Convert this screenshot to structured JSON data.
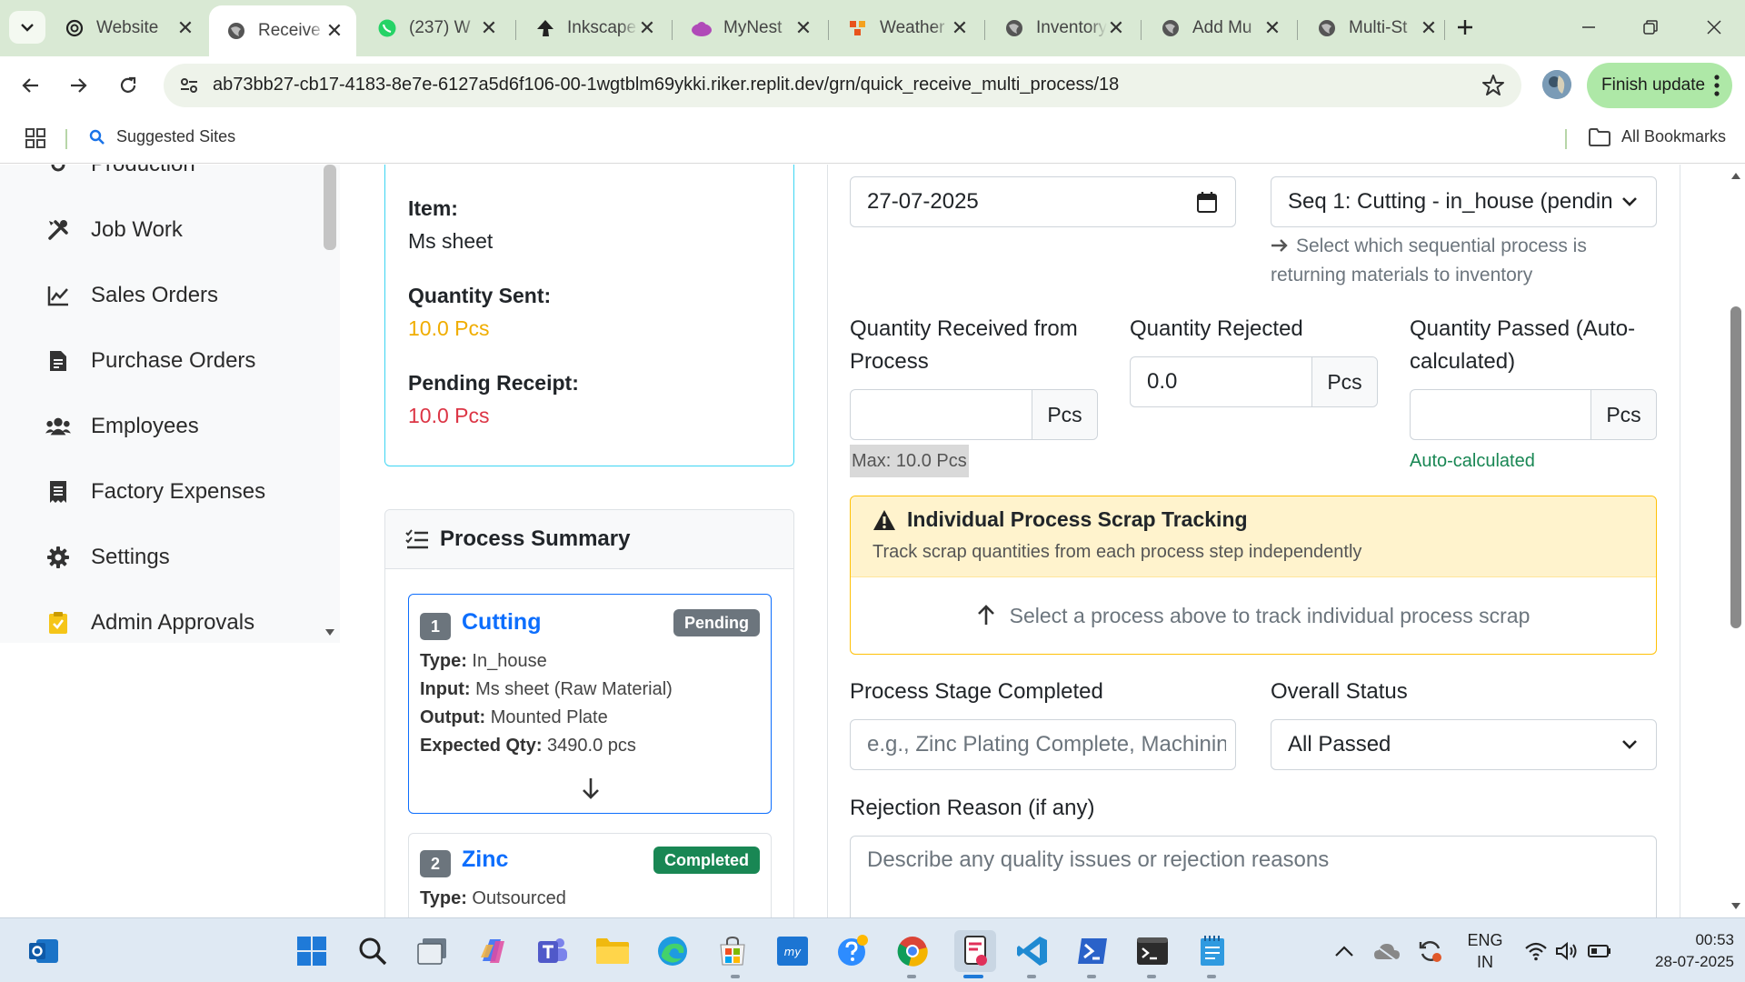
{
  "browser": {
    "tabs": [
      {
        "title": "Website",
        "icon": "openai-icon",
        "active": false
      },
      {
        "title": "Receive",
        "icon": "globe-icon",
        "active": true
      },
      {
        "title": "(237) W",
        "icon": "whatsapp-icon",
        "active": false
      },
      {
        "title": "Inkscape",
        "icon": "inkscape-icon",
        "active": false
      },
      {
        "title": "MyNest",
        "icon": "cloud-icon",
        "active": false
      },
      {
        "title": "Weather",
        "icon": "weather-icon",
        "active": false
      },
      {
        "title": "Inventory",
        "icon": "globe-icon",
        "active": false
      },
      {
        "title": "Add Mu",
        "icon": "globe-icon",
        "active": false
      },
      {
        "title": "Multi-St",
        "icon": "globe-icon",
        "active": false
      }
    ],
    "url": "ab73bb27-cb17-4183-8e7e-6127a5d6f106-00-1wgtblm69ykki.riker.replit.dev/grn/quick_receive_multi_process/18",
    "finish_update": "Finish update",
    "bookmarks": {
      "suggested": "Suggested Sites",
      "all": "All Bookmarks"
    }
  },
  "sidebar": {
    "items": [
      {
        "label": "Production",
        "icon": "production-icon"
      },
      {
        "label": "Job Work",
        "icon": "tools-icon"
      },
      {
        "label": "Sales Orders",
        "icon": "chart-line-icon"
      },
      {
        "label": "Purchase Orders",
        "icon": "document-icon"
      },
      {
        "label": "Employees",
        "icon": "users-icon"
      },
      {
        "label": "Factory Expenses",
        "icon": "receipt-icon"
      },
      {
        "label": "Settings",
        "icon": "gear-icon"
      },
      {
        "label": "Admin Approvals",
        "icon": "clipboard-check-icon"
      }
    ]
  },
  "info_card": {
    "item_label": "Item:",
    "item_value": "Ms sheet",
    "qty_sent_label": "Quantity Sent:",
    "qty_sent_value": "10.0 Pcs",
    "pending_label": "Pending Receipt:",
    "pending_value": "10.0 Pcs"
  },
  "process_summary": {
    "title": "Process Summary",
    "processes": [
      {
        "seq": "1",
        "name": "Cutting",
        "status": "Pending",
        "type_label": "Type:",
        "type": "In_house",
        "input_label": "Input:",
        "input": "Ms sheet (Raw Material)",
        "output_label": "Output:",
        "output": "Mounted Plate",
        "expected_label": "Expected Qty:",
        "expected": "3490.0 pcs"
      },
      {
        "seq": "2",
        "name": "Zinc",
        "status": "Completed",
        "type_label": "Type:",
        "type": "Outsourced"
      }
    ]
  },
  "form": {
    "date_value": "27-07-2025",
    "process_select": "Seq 1: Cutting - in_house (pendin",
    "process_hint": "Select which sequential process is returning materials to inventory",
    "qty_received_label": "Quantity Received from Process",
    "qty_received_value": "",
    "qty_received_unit": "Pcs",
    "qty_received_max": "Max: 10.0 Pcs",
    "qty_rejected_label": "Quantity Rejected",
    "qty_rejected_value": "0.0",
    "qty_rejected_unit": "Pcs",
    "qty_passed_label": "Quantity Passed (Auto-calculated)",
    "qty_passed_value": "",
    "qty_passed_unit": "Pcs",
    "qty_passed_note": "Auto-calculated",
    "scrap": {
      "title": "Individual Process Scrap Tracking",
      "subtitle": "Track scrap quantities from each process step independently",
      "body": "Select a process above to track individual process scrap"
    },
    "stage_label": "Process Stage Completed",
    "stage_placeholder": "e.g., Zinc Plating Complete, Machining Done",
    "status_label": "Overall Status",
    "status_value": "All Passed",
    "rejection_label": "Rejection Reason (if any)",
    "rejection_placeholder": "Describe any quality issues or rejection reasons"
  },
  "taskbar": {
    "lang_top": "ENG",
    "lang_bottom": "IN",
    "time": "00:53",
    "date": "28-07-2025"
  },
  "colors": {
    "tabstrip": "#d9e9d4",
    "primary": "#0d6efd",
    "warning_text": "#ffc107",
    "danger_text": "#dc3545",
    "success": "#198754",
    "pending_badge": "#6c757d",
    "scrap_border": "#ffc107",
    "scrap_header_bg": "#fff3cd"
  }
}
